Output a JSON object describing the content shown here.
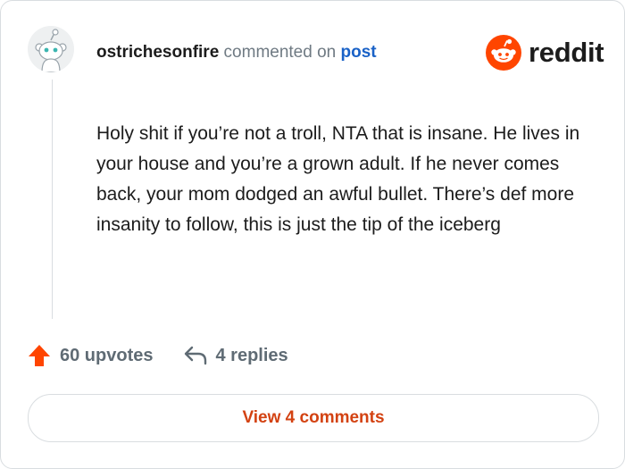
{
  "comment": {
    "username": "ostrichesonfire",
    "action_text": "commented on",
    "post_link": "post",
    "body": "Holy shit if you’re not a troll, NTA that is insane. He lives in your house and you’re a grown adult. If he never comes back, your mom dodged an awful bullet. There’s def more insanity to follow, this is just the tip of the iceberg",
    "upvotes_label": "60 upvotes",
    "replies_label": "4 replies",
    "view_comments_label": "View 4 comments"
  },
  "brand": {
    "name": "reddit",
    "accent_color": "#ff4500",
    "link_color": "#1a62c7"
  },
  "icons": {
    "avatar": "snoo-avatar-icon",
    "logo": "reddit-snoo-icon",
    "upvote": "upvote-arrow-icon",
    "reply": "reply-arrow-icon"
  }
}
